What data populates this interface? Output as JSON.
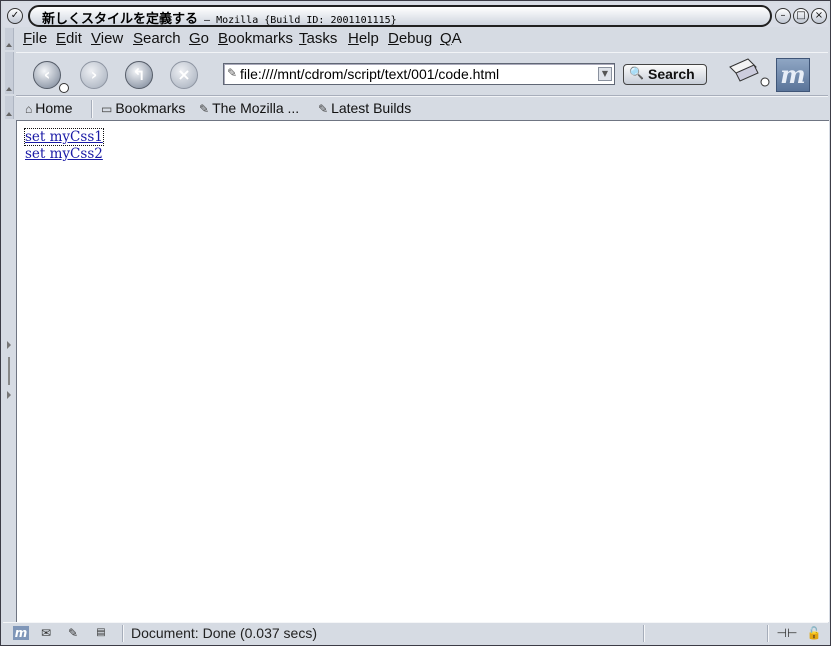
{
  "window": {
    "title_main": "新しくスタイルを定義する",
    "title_suffix": " – Mozilla {Build ID: 2001101115}",
    "buttons": [
      "minimize",
      "maximize",
      "close"
    ]
  },
  "menu": {
    "items": [
      "File",
      "Edit",
      "View",
      "Search",
      "Go",
      "Bookmarks",
      "Tasks",
      "Help",
      "Debug",
      "QA"
    ]
  },
  "navigation": {
    "back_icon": "back-arrow-icon",
    "forward_icon": "forward-arrow-icon",
    "reload_icon": "reload-icon",
    "stop_icon": "stop-icon",
    "url": "file:////mnt/cdrom/script/text/001/code.html",
    "search_label": "Search"
  },
  "personal_toolbar": {
    "items": [
      {
        "label": "Home",
        "icon": "home-icon"
      },
      {
        "label": "Bookmarks",
        "icon": "folder-icon"
      },
      {
        "label": "The Mozilla ...",
        "icon": "bookmark-icon"
      },
      {
        "label": "Latest Builds",
        "icon": "bookmark-icon"
      }
    ]
  },
  "page": {
    "links": [
      "set myCss1",
      "set myCss2"
    ]
  },
  "status": {
    "text": "Document: Done (0.037 secs)"
  },
  "colors": {
    "chrome": "#d6dbe3",
    "link": "#1a1aa6",
    "content_bg": "#ffffff"
  }
}
